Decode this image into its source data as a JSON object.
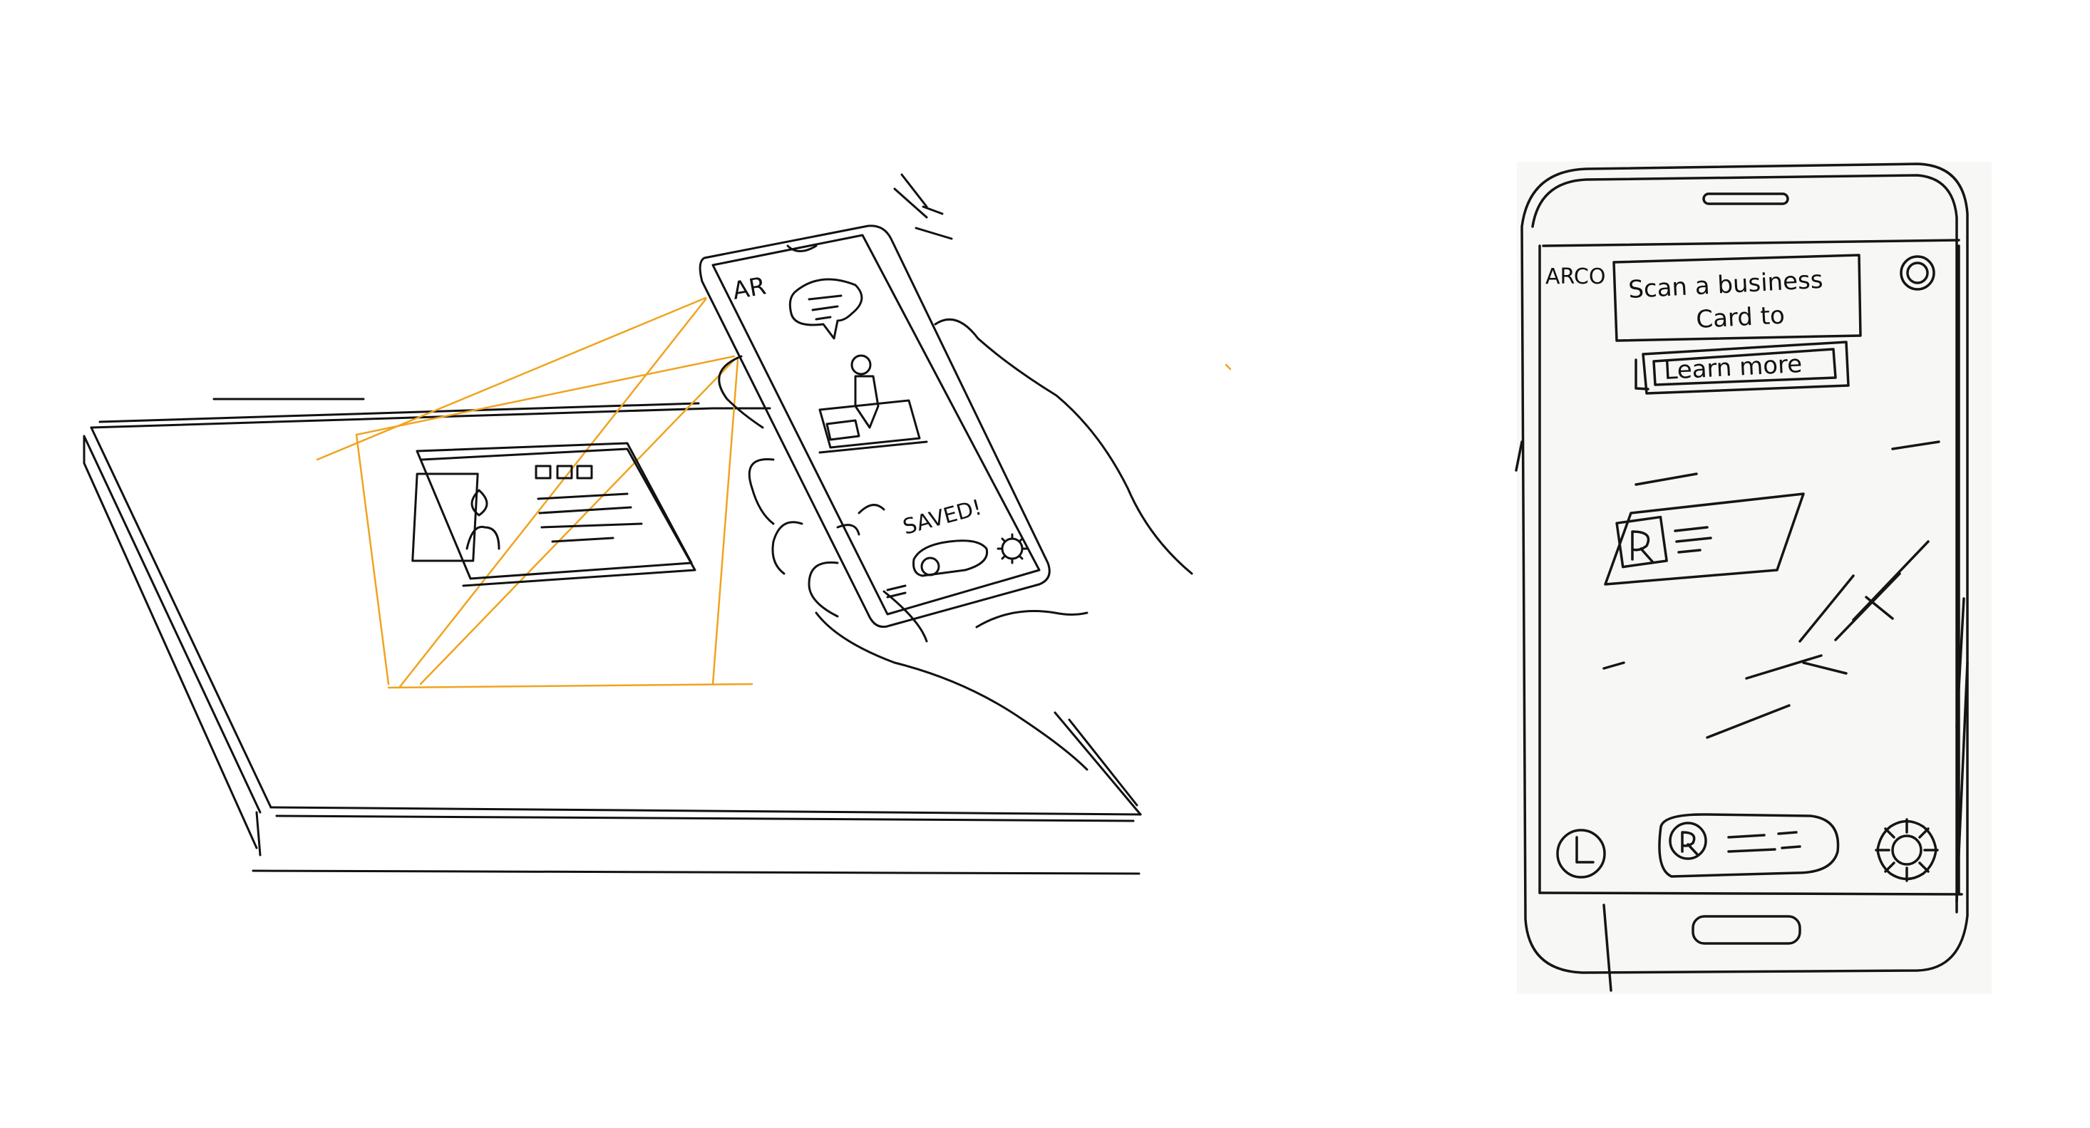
{
  "left_sketch": {
    "ar_label": "AR",
    "saved_label": "SAVED!",
    "colors": {
      "ink": "#111111",
      "scan_lines": "#f0a31e"
    }
  },
  "right_sketch": {
    "app_label": "ARCO",
    "prompt_line1": "Scan a business",
    "prompt_line2": "Card to",
    "learn_more_label": "Learn more",
    "colors": {
      "ink": "#151515",
      "paper": "#f7f7f5"
    }
  }
}
